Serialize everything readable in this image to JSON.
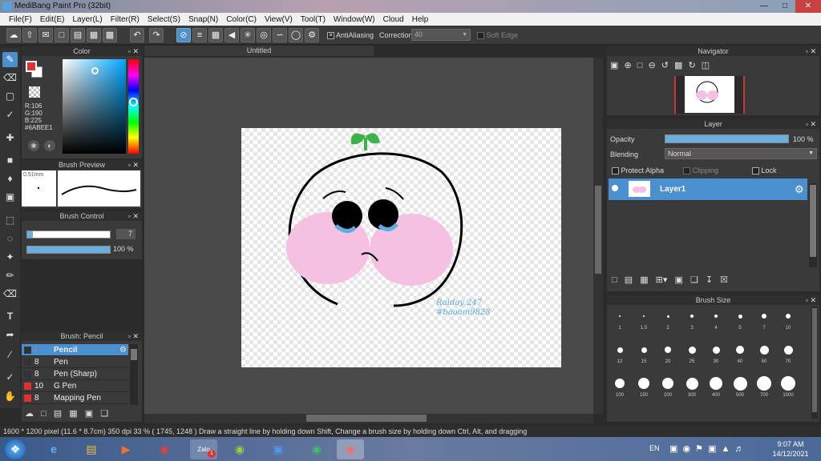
{
  "app": {
    "title": "MediBang Paint Pro (32bit)"
  },
  "menu": [
    "File(F)",
    "Edit(E)",
    "Layer(L)",
    "Filter(R)",
    "Select(S)",
    "Snap(N)",
    "Color(C)",
    "View(V)",
    "Tool(T)",
    "Window(W)",
    "Cloud",
    "Help"
  ],
  "toolbar": {
    "antialiasing_label": "AntiAliasing",
    "correction_label": "Correction",
    "correction_value": "40",
    "soft_edge_label": "Soft Edge"
  },
  "color_panel": {
    "title": "Color",
    "r": "R:106",
    "g": "G:190",
    "b": "B:225",
    "hex": "#6ABEE1",
    "fg": "#e03030",
    "bg": "#ffffff",
    "hue_color": "#00c8ff"
  },
  "brush_preview": {
    "title": "Brush Preview",
    "size": "0.51mm"
  },
  "brush_control": {
    "title": "Brush Control",
    "size_value": "7",
    "size_fraction": 0.07,
    "opacity_value": "100 %",
    "opacity_fraction": 1.0
  },
  "brush_list": {
    "title": "Brush: Pencil",
    "items": [
      {
        "num": "",
        "name": "Pencil",
        "color": "#333333",
        "selected": true
      },
      {
        "num": "8",
        "name": "Pen",
        "color": "#333333",
        "selected": false
      },
      {
        "num": "8",
        "name": "Pen (Sharp)",
        "color": "#333333",
        "selected": false
      },
      {
        "num": "10",
        "name": "G Pen",
        "color": "#e03030",
        "selected": false
      },
      {
        "num": "8",
        "name": "Mapping Pen",
        "color": "#e03030",
        "selected": false
      }
    ]
  },
  "canvas": {
    "tab_title": "Untitled",
    "signature_line1": "Raiday 247",
    "signature_line2": "#baoam9828"
  },
  "navigator": {
    "title": "Navigator"
  },
  "layer_panel": {
    "title": "Layer",
    "opacity_label": "Opacity",
    "opacity_value": "100 %",
    "opacity_fraction": 1.0,
    "blending_label": "Blending",
    "blending_value": "Normal",
    "protect_alpha": "Protect Alpha",
    "clipping": "Clipping",
    "lock": "Lock",
    "layers": [
      {
        "name": "Layer1"
      }
    ]
  },
  "brush_size": {
    "title": "Brush Size",
    "sizes": [
      "1",
      "1.5",
      "2",
      "3",
      "4",
      "5",
      "7",
      "10",
      "12",
      "15",
      "20",
      "25",
      "30",
      "40",
      "50",
      "70",
      "100",
      "150",
      "200",
      "300",
      "400",
      "500",
      "700",
      "1000"
    ]
  },
  "status": {
    "text": "1600 * 1200 pixel  (11.6 * 8.7cm)  350 dpi  33 %  ( 1745, 1248 )  Draw a straight line by holding down Shift, Change a brush size by holding down Ctrl, Alt, and dragging"
  },
  "taskbar": {
    "lang": "EN",
    "time": "9:07 AM",
    "date": "14/12/2021",
    "zalo_label": "Zalo",
    "zalo_badge": "1"
  }
}
